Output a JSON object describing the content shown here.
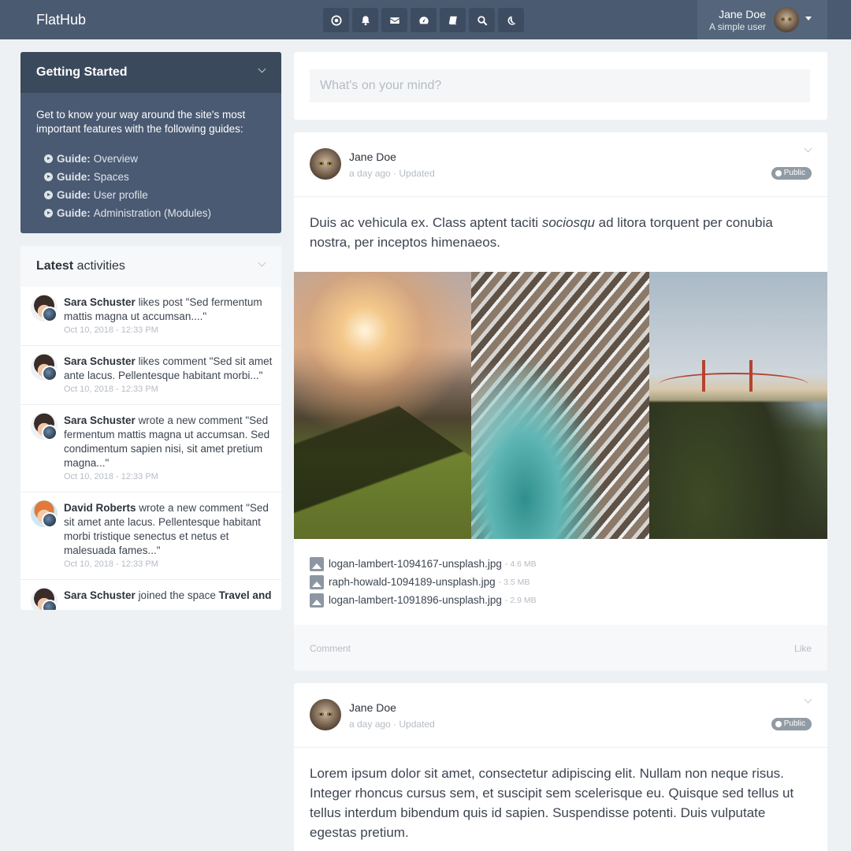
{
  "brand": "FlatHub",
  "nav_icons": [
    "dashboard-icon",
    "bell-icon",
    "envelope-icon",
    "tachometer-icon",
    "book-icon",
    "search-icon",
    "moon-icon"
  ],
  "user": {
    "name": "Jane Doe",
    "subtitle": "A simple user"
  },
  "getting_started": {
    "title_bold": "Getting",
    "title_rest": "Started",
    "intro": "Get to know your way around the site's most important features with the following guides:",
    "guides": [
      {
        "prefix": "Guide:",
        "label": "Overview"
      },
      {
        "prefix": "Guide:",
        "label": "Spaces"
      },
      {
        "prefix": "Guide:",
        "label": "User profile"
      },
      {
        "prefix": "Guide:",
        "label": "Administration (Modules)"
      }
    ]
  },
  "activities": {
    "title_bold": "Latest",
    "title_rest": "activities",
    "items": [
      {
        "user": "Sara Schuster",
        "action": "likes post \"Sed fermentum mattis magna ut accumsan....\"",
        "time": "Oct 10, 2018 - 12:33 PM"
      },
      {
        "user": "Sara Schuster",
        "action": "likes comment \"Sed sit amet ante lacus. Pellentesque habitant morbi...\"",
        "time": "Oct 10, 2018 - 12:33 PM"
      },
      {
        "user": "Sara Schuster",
        "action": "wrote a new comment \"Sed fermentum mattis magna ut accumsan. Sed condimentum sapien nisi, sit amet pretium magna...\"",
        "time": "Oct 10, 2018 - 12:33 PM"
      },
      {
        "user": "David Roberts",
        "action": "wrote a new comment \"Sed sit amet ante lacus. Pellentesque habitant morbi tristique senectus et netus et malesuada fames...\"",
        "time": "Oct 10, 2018 - 12:33 PM"
      },
      {
        "user": "Sara Schuster",
        "action": "joined the space",
        "space": "Travel and",
        "time": ""
      }
    ]
  },
  "composer": {
    "placeholder": "What's on your mind?"
  },
  "posts": [
    {
      "author": "Jane Doe",
      "time": "a day ago",
      "sep": " · ",
      "updated": "Updated",
      "visibility": "Public",
      "text_before": "Duis ac vehicula ex. Class aptent taciti ",
      "text_italic": "sociosqu",
      "text_after": " ad litora torquent per conubia nostra, per inceptos himenaeos.",
      "files": [
        {
          "name": "logan-lambert-1094167-unsplash.jpg",
          "size": "- 4.6 MB"
        },
        {
          "name": "raph-howald-1094189-unsplash.jpg",
          "size": "- 3.5 MB"
        },
        {
          "name": "logan-lambert-1091896-unsplash.jpg",
          "size": "- 2.9 MB"
        }
      ],
      "comment_label": "Comment",
      "like_label": "Like"
    },
    {
      "author": "Jane Doe",
      "time": "a day ago",
      "sep": " · ",
      "updated": "Updated",
      "visibility": "Public",
      "text": "Lorem ipsum dolor sit amet, consectetur adipiscing elit. Nullam non neque risus. Integer rhoncus cursus sem, et suscipit sem scelerisque eu. Quisque sed tellus ut tellus interdum bibendum quis id sapien. Suspendisse potenti. Duis vulputate egestas pretium."
    }
  ]
}
